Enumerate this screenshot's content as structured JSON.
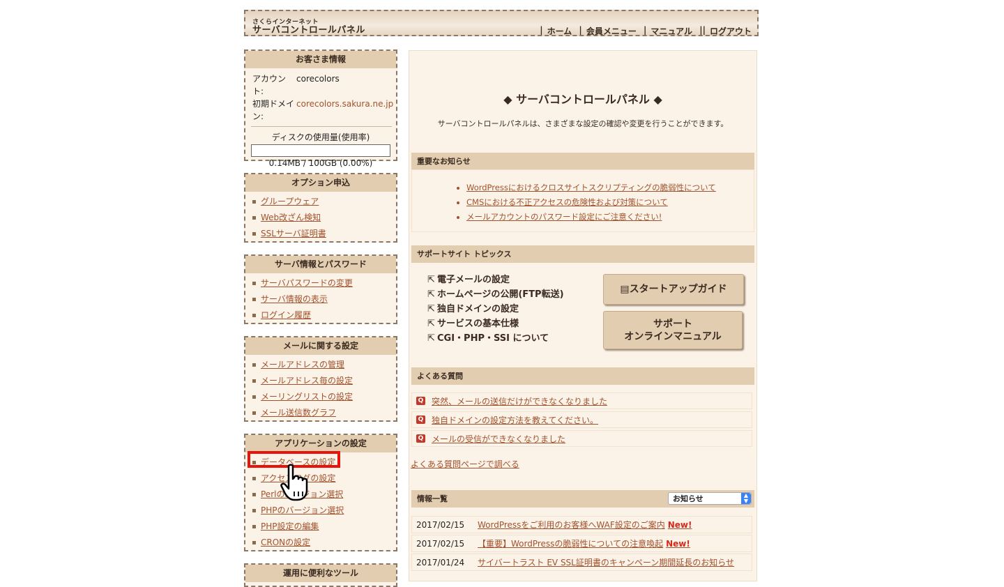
{
  "header": {
    "logo_small": "さくらインターネット",
    "logo_big": "サーバコントロールパネル",
    "nav": [
      "ホーム",
      "会員メニュー",
      "マニュアル",
      "ログアウト"
    ]
  },
  "customer": {
    "title": "お客さま情報",
    "account_label": "アカウント:",
    "account_value": "corecolors",
    "domain_label_1": "初期ドメイ",
    "domain_label_2": "ン:",
    "domain_value": "corecolors.sakura.ne.jp",
    "disk_title": "ディスクの使用量(使用率)",
    "disk_usage_percent": 0.0,
    "disk_value": "0.14MB / 100GB (0.00%)"
  },
  "sidebar": {
    "option": {
      "title": "オプション申込",
      "items": [
        "グループウェア",
        "Web改ざん検知",
        "SSLサーバ証明書"
      ]
    },
    "server": {
      "title": "サーバ情報とパスワード",
      "items": [
        "サーバパスワードの変更",
        "サーバ情報の表示",
        "ログイン履歴"
      ]
    },
    "mail": {
      "title": "メールに関する設定",
      "items": [
        "メールアドレスの管理",
        "メールアドレス毎の設定",
        "メーリングリストの設定",
        "メール送信数グラフ"
      ]
    },
    "app": {
      "title": "アプリケーションの設定",
      "items": [
        "データベースの設定",
        "アクセスログの設定",
        "Perlのバージョン選択",
        "PHPのバージョン選択",
        "PHP設定の編集",
        "CRONの設定"
      ]
    },
    "tools": {
      "title": "運用に便利なツール"
    }
  },
  "main": {
    "title": "◆ サーバコントロールパネル ◆",
    "description": "サーバコントロールパネルは、さまざまな設定の確認や変更を行うことができます。",
    "notice_title": "重要なお知らせ",
    "notices": [
      "WordPressにおけるクロスサイトスクリプティングの脆弱性について",
      "CMSにおける不正アクセスの危険性および対策について",
      "メールアカウントのパスワード設定にご注意ください!"
    ],
    "topics_title": "サポートサイト トピックス",
    "topics": [
      "電子メールの設定",
      "ホームページの公開(FTP転送)",
      "独自ドメインの設定",
      "サービスの基本仕様",
      "CGI・PHP・SSI について"
    ],
    "startup_button": "スタートアップガイド",
    "manual_button_line1": "サポート",
    "manual_button_line2": "オンラインマニュアル",
    "faq_title": "よくある質問",
    "faq_badge": "Q",
    "faqs": [
      "突然、メールの送信だけができなくなりました",
      "独自ドメインの設定方法を教えてください。",
      "メールの受信ができなくなりました"
    ],
    "faq_more": "よくある質問ページで調べる",
    "news_title": "情報一覧",
    "news_select": "お知らせ",
    "news_new": "New!",
    "news": [
      {
        "date": "2017/02/15",
        "title": "WordPressをご利用のお客様へWAF設定のご案内",
        "is_new": true
      },
      {
        "date": "2017/02/15",
        "title": "【重要】WordPressの脆弱性についての注意喚起",
        "is_new": true
      },
      {
        "date": "2017/01/24",
        "title": "サイバートラスト EV SSL証明書のキャンペーン期間延長のお知らせ",
        "is_new": false
      }
    ]
  },
  "icons": {
    "external_link": "external-link-icon",
    "book": "book-icon",
    "pointer": "hand-pointer-icon",
    "bullet": "square-bullet-icon"
  }
}
